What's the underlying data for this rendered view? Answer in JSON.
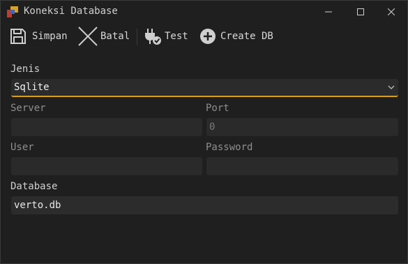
{
  "window": {
    "title": "Koneksi Database",
    "controls": [
      "minimize-icon",
      "maximize-icon",
      "close-icon"
    ]
  },
  "toolbar": {
    "save_label": "Simpan",
    "cancel_label": "Batal",
    "test_label": "Test",
    "create_label": "Create DB",
    "icons": [
      "save-icon",
      "close-x-icon",
      "plug-check-icon",
      "plus-circle-icon"
    ]
  },
  "form": {
    "jenis_label": "Jenis",
    "jenis_value": "Sqlite",
    "server_label": "Server",
    "server_value": "",
    "port_label": "Port",
    "port_value": "0",
    "user_label": "User",
    "user_value": "",
    "password_label": "Password",
    "password_value": "",
    "database_label": "Database",
    "database_value": "verto.db"
  },
  "colors": {
    "background": "#1f1f1f",
    "field": "#2c2c2c",
    "accent": "#d6a017"
  }
}
